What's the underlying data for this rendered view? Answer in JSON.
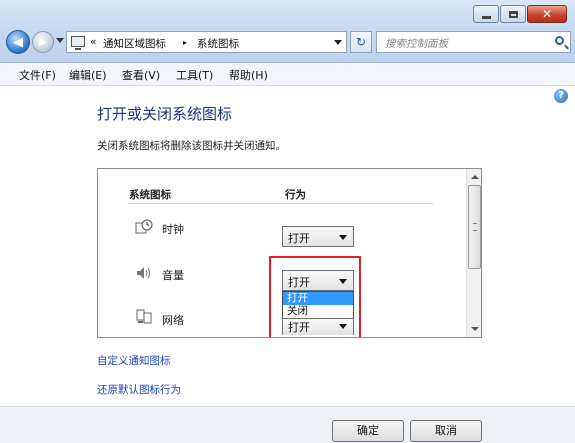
{
  "window": {
    "controls": {
      "minimize": "minimize",
      "maximize": "maximize",
      "close": "✕"
    }
  },
  "address": {
    "prefix": "«",
    "crumbs": [
      "通知区域图标",
      "系统图标"
    ],
    "separator": "▸"
  },
  "search": {
    "placeholder": "搜索控制面板"
  },
  "menu": [
    "文件(F)",
    "编辑(E)",
    "查看(V)",
    "工具(T)",
    "帮助(H)"
  ],
  "page": {
    "title": "打开或关闭系统图标",
    "description": "关闭系统图标将删除该图标并关闭通知。"
  },
  "table": {
    "headers": {
      "icon": "系统图标",
      "behavior": "行为"
    },
    "rows": [
      {
        "label": "时钟",
        "icon": "clock-icon",
        "value": "打开"
      },
      {
        "label": "音量",
        "icon": "volume-icon",
        "value": "打开"
      },
      {
        "label": "网络",
        "icon": "network-icon",
        "value": "打开"
      }
    ],
    "dropdown_options": [
      "打开",
      "关闭"
    ]
  },
  "links": {
    "customize": "自定义通知图标",
    "restore": "还原默认图标行为"
  },
  "footer": {
    "ok": "确定",
    "cancel": "取消"
  },
  "colors": {
    "title": "#1e3287",
    "link": "#1a44b8",
    "highlight": "#3399ff",
    "annotation": "#e0202a"
  }
}
